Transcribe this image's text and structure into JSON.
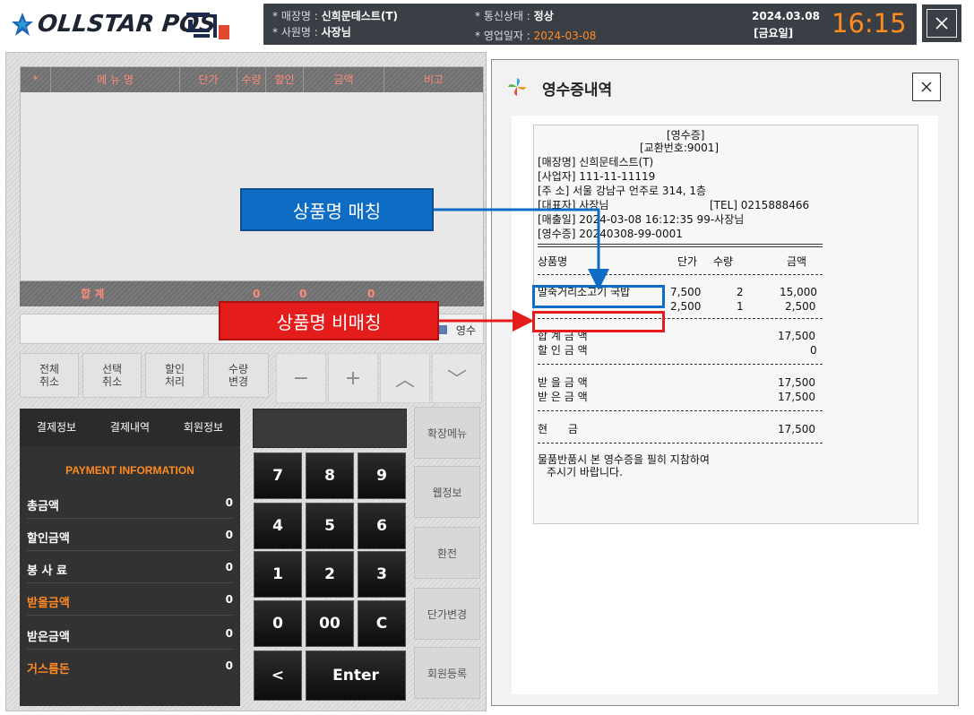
{
  "header": {
    "logo_text": "OLLSTAR POS",
    "store_label": "* 매장명 : ",
    "store_value": "신희문테스트(T)",
    "staff_label": "* 사원명 : ",
    "staff_value": "사장님",
    "comm_label": "* 통신상태 : ",
    "comm_value": "정상",
    "bizdate_label": "* 영업일자 : ",
    "bizdate_value": "2024-03-08",
    "date": "2024.03.08",
    "weekday": "[금요일]",
    "time": "16:15"
  },
  "order_table": {
    "columns": [
      "*",
      "메 뉴 명",
      "단가",
      "수량",
      "할인",
      "금액",
      "비고"
    ],
    "total_label": "합 계",
    "total_values": [
      "0",
      "0",
      "0"
    ],
    "receipt_label": "영수"
  },
  "function_buttons": [
    {
      "label": "전체\n취소"
    },
    {
      "label": "선택\n취소"
    },
    {
      "label": "할인\n처리"
    },
    {
      "label": "수량\n변경"
    }
  ],
  "symbol_buttons": [
    "−",
    "+",
    "︿",
    "﹀"
  ],
  "payment": {
    "tabs": [
      "결제정보",
      "결제내역",
      "회원정보"
    ],
    "title": "PAYMENT INFORMATION",
    "rows": [
      {
        "label": "총금액",
        "value": "0",
        "color": "#ffffff"
      },
      {
        "label": "할인금액",
        "value": "0",
        "color": "#ffffff"
      },
      {
        "label": "봉 사 료",
        "value": "0",
        "color": "#ffffff"
      },
      {
        "label": "받을금액",
        "value": "0",
        "color": "#ff8a1f"
      },
      {
        "label": "받은금액",
        "value": "0",
        "color": "#ffffff"
      },
      {
        "label": "거스름돈",
        "value": "0",
        "color": "#ff8a1f"
      }
    ]
  },
  "keypad": {
    "rows": [
      [
        "7",
        "8",
        "9"
      ],
      [
        "4",
        "5",
        "6"
      ],
      [
        "1",
        "2",
        "3"
      ],
      [
        "0",
        "00",
        "C"
      ]
    ],
    "back": "<",
    "enter": "Enter"
  },
  "side_buttons": [
    "확장메뉴",
    "웹정보",
    "환전",
    "단가변경",
    "회원등록"
  ],
  "dialog": {
    "title": "영수증내역",
    "receipt": {
      "title": "[영수증]",
      "exchange_no": "[교환번호:9001]",
      "store": "[매장명] 신희문테스트(T)",
      "business_no": "[사업자] 111-11-11119",
      "address": "[주  소] 서울 강남구 언주로  314, 1층",
      "owner": "[대표자] 사장님",
      "tel": "[TEL] 0215888466",
      "sale": "[매출일] 2024-03-08 16:12:35 99-사장님",
      "receipt_no": "[영수증] 20240308-99-0001",
      "columns": [
        "상품명",
        "단가",
        "수량",
        "금액"
      ],
      "items": [
        {
          "name": "말죽거리소고기 국밥",
          "price": "7,500",
          "qty": "2",
          "amount": "15,000"
        },
        {
          "name": "",
          "price": "2,500",
          "qty": "1",
          "amount": "2,500"
        }
      ],
      "total_label": "합 계  금 액",
      "total": "17,500",
      "discount_label": "할 인  금 액",
      "discount": "0",
      "to_receive_label": "받 을  금 액",
      "to_receive": "17,500",
      "received_label": "받 은  금 액",
      "received": "17,500",
      "cash_label": "현      금",
      "cash": "17,500",
      "notice_1": "물품반품시 본 영수증을 필히 지참하여",
      "notice_2": "주시기 바랍니다."
    }
  },
  "callouts": {
    "matched": "상품명 매칭",
    "unmatched": "상품명 비매칭",
    "matched_color": "#0f6cc4",
    "unmatched_color": "#e51c1c"
  }
}
